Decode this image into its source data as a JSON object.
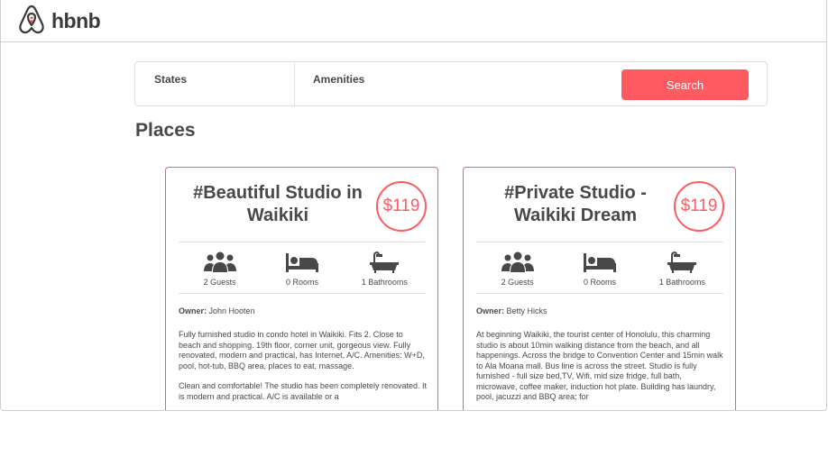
{
  "app": {
    "logo_text": "hbnb",
    "accent_color": "#ff5a5f"
  },
  "filters": {
    "states_label": "States",
    "amenities_label": "Amenities",
    "search_label": "Search"
  },
  "places": {
    "title": "Places",
    "items": [
      {
        "name": "#Beautiful Studio in Waikiki",
        "price": "$119",
        "guests": "2 Guests",
        "rooms": "0 Rooms",
        "bathrooms": "1 Bathrooms",
        "owner_label": "Owner:",
        "owner_name": "John Hooten",
        "description_1": "Fully furnished studio in condo hotel in Waikiki. Fits 2. Close to beach and shopping. 19th floor, corner unit, gorgeous view. Fully renovated, modern and practical, has Internet, A/C. Amenities: W+D, pool, hot-tub, BBQ area, places to eat, massage.",
        "description_2": "Clean and comfortable! The studio has been completely renovated. It is modern and practical. A/C is available or a"
      },
      {
        "name": "#Private Studio - Waikiki Dream",
        "price": "$119",
        "guests": "2 Guests",
        "rooms": "0 Rooms",
        "bathrooms": "1 Bathrooms",
        "owner_label": "Owner:",
        "owner_name": "Betty Hicks",
        "description_1": "At beginning Waikiki, the tourist center of Honolulu, this charming studio is about 10min walking distance from the beach, and all happenings. Across the bridge to Convention Center and 15min walk to Ala Moana mall. Bus line is across the street. Studio is fully furnished - full size bed,TV, Wifi, mid size fridge, full bath, microwave, coffee maker, induction hot plate. Building has laundry, pool, jacuzzi and BBQ area; for",
        "description_2": ""
      }
    ]
  },
  "icons": {
    "logo": "airbnb-logo-icon",
    "guests": "users-icon",
    "rooms": "bed-icon",
    "bathrooms": "bath-icon"
  }
}
